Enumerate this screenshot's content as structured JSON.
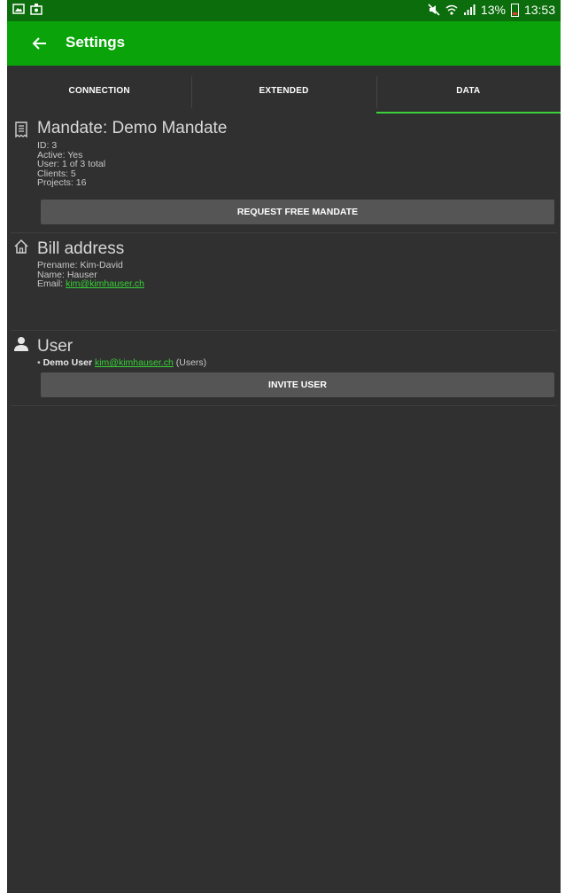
{
  "status_bar": {
    "battery": "13%",
    "time": "13:53"
  },
  "app_bar": {
    "title": "Settings",
    "back_icon": "arrow-back-icon"
  },
  "tabs": [
    {
      "label": "CONNECTION",
      "active": false
    },
    {
      "label": "EXTENDED",
      "active": false
    },
    {
      "label": "DATA",
      "active": true
    }
  ],
  "mandate": {
    "icon": "receipt-icon",
    "title": "Mandate: Demo Mandate",
    "lines": [
      "ID: 3",
      "Active: Yes",
      "User: 1 of 3 total",
      "Clients: 5",
      "Projects: 16"
    ],
    "button": "REQUEST FREE MANDATE"
  },
  "bill_address": {
    "icon": "home-icon",
    "title": "Bill address",
    "prename": "Prename: Kim-David",
    "name": "Name: Hauser",
    "email_label": "Email: ",
    "email": "kim@kimhauser.ch"
  },
  "user": {
    "icon": "person-icon",
    "title": "User",
    "bullet": "• ",
    "user_name": "Demo User",
    "email": "kim@kimhauser.ch",
    "role": " (Users)",
    "button": "INVITE USER"
  },
  "colors": {
    "status_bar": "#0b6d0b",
    "app_bar": "#0aa40a",
    "background": "#303030",
    "accent": "#35d135",
    "button": "#555555"
  }
}
